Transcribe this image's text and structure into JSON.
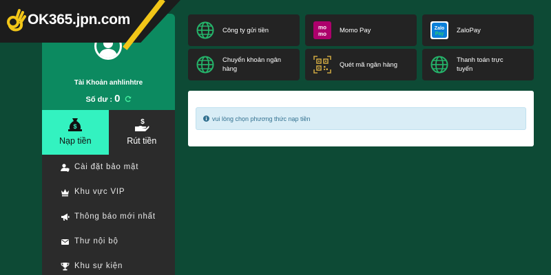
{
  "logo": {
    "text": "OK365.jpn.com"
  },
  "profile": {
    "account_label": "Tài Khoản anhlinhtre",
    "balance_label": "Số dư :",
    "balance_value": "0"
  },
  "tabs": [
    {
      "label": "Nạp tiền",
      "icon": "money-bag-icon",
      "active": true
    },
    {
      "label": "Rút tiền",
      "icon": "hand-cash-icon",
      "active": false
    }
  ],
  "menu": [
    {
      "label": "Cài đặt bảo mật",
      "icon": "user-shield-icon"
    },
    {
      "label": "Khu vực VIP",
      "icon": "crown-icon"
    },
    {
      "label": "Thông báo mới nhất",
      "icon": "megaphone-icon"
    },
    {
      "label": "Thư nội bộ",
      "icon": "envelope-icon"
    },
    {
      "label": "Khu sự kiện",
      "icon": "trophy-icon"
    }
  ],
  "payment_methods": [
    {
      "label": "Công ty gửi tiền",
      "icon": "globe-icon"
    },
    {
      "label": "Momo Pay",
      "icon": "momo-icon"
    },
    {
      "label": "ZaloPay",
      "icon": "zalopay-icon"
    },
    {
      "label": "Chuyển khoản ngân hàng",
      "icon": "globe-icon"
    },
    {
      "label": "Quét mã ngân hàng",
      "icon": "qr-code-icon"
    },
    {
      "label": "Thanh toán trực tuyến",
      "icon": "globe-icon"
    }
  ],
  "alert": {
    "text": "vui lòng chọn phương thức nạp tiền"
  },
  "colors": {
    "background": "#0d4a35",
    "profile": "#0c8a60",
    "active_tab": "#33f2c0",
    "panel_dark": "#2b2b2b",
    "card": "#232323",
    "globe_green": "#25b36a",
    "logo_accent": "#f2c618"
  }
}
